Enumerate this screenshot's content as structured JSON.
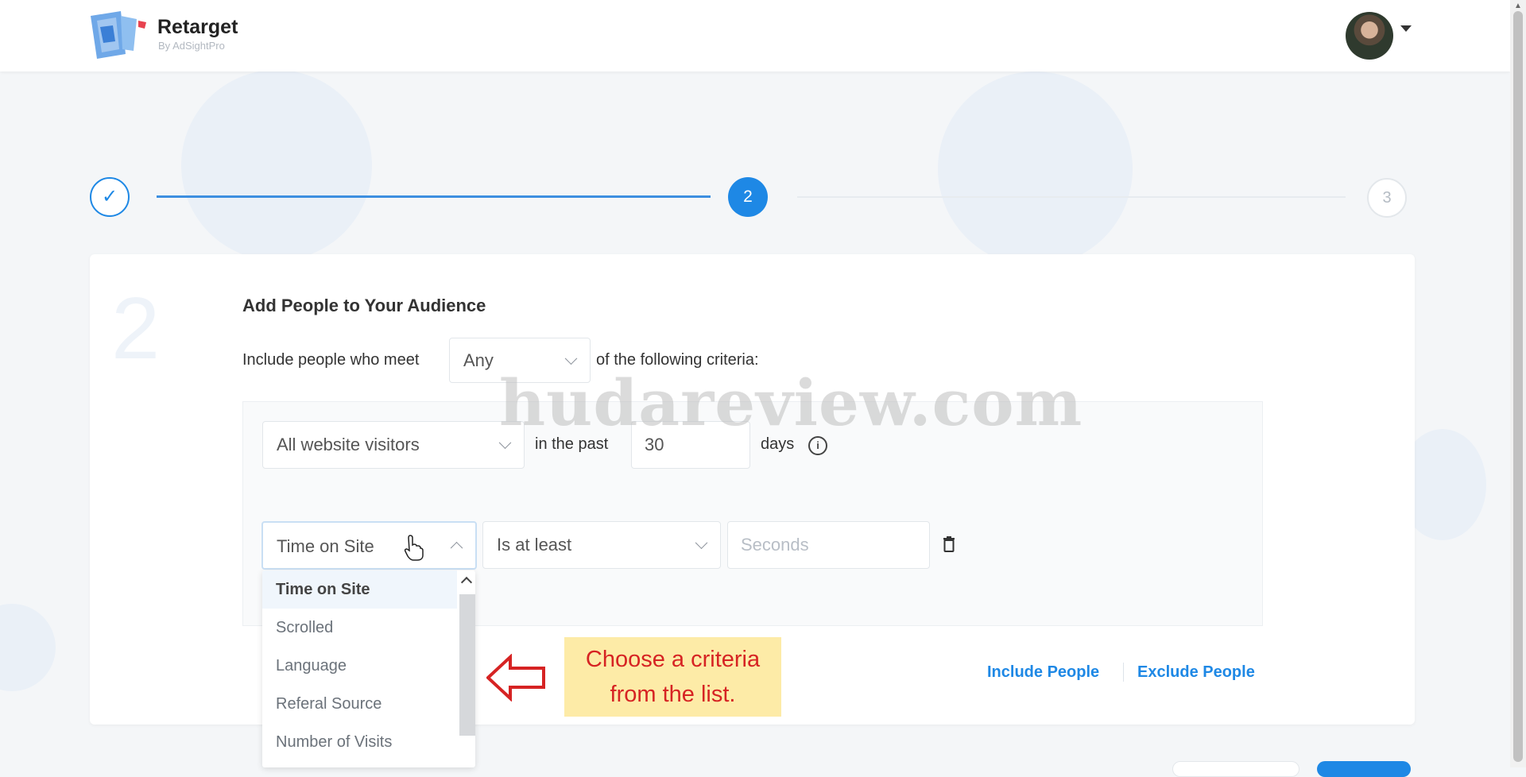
{
  "brand": {
    "name": "Retarget",
    "subtitle": "By AdSightPro"
  },
  "stepper": {
    "step1_icon": "check-icon",
    "step2_label": "2",
    "step3_label": "3",
    "current_step": 2
  },
  "card": {
    "step_number": "2",
    "title": "Add People to Your Audience",
    "include_prefix": "Include people who meet",
    "match_select": "Any",
    "include_suffix": "of the following criteria:",
    "visitors_select": "All website visitors",
    "in_the_past_label": "in the past",
    "days_value": "30",
    "days_label": "days",
    "criteria_select": "Time on Site",
    "condition_select": "Is at least",
    "seconds_placeholder": "Seconds",
    "dropdown_options": [
      "Time on Site",
      "Scrolled",
      "Language",
      "Referal Source",
      "Number of Visits"
    ],
    "include_people": "Include People",
    "exclude_people": "Exclude People"
  },
  "annotation": {
    "line1": "Choose a criteria",
    "line2": "from the list."
  },
  "watermark": "hudareview.com",
  "colors": {
    "accent": "#1e88e5",
    "annotation_bg": "#fdeba7",
    "annotation_text": "#d62323"
  }
}
